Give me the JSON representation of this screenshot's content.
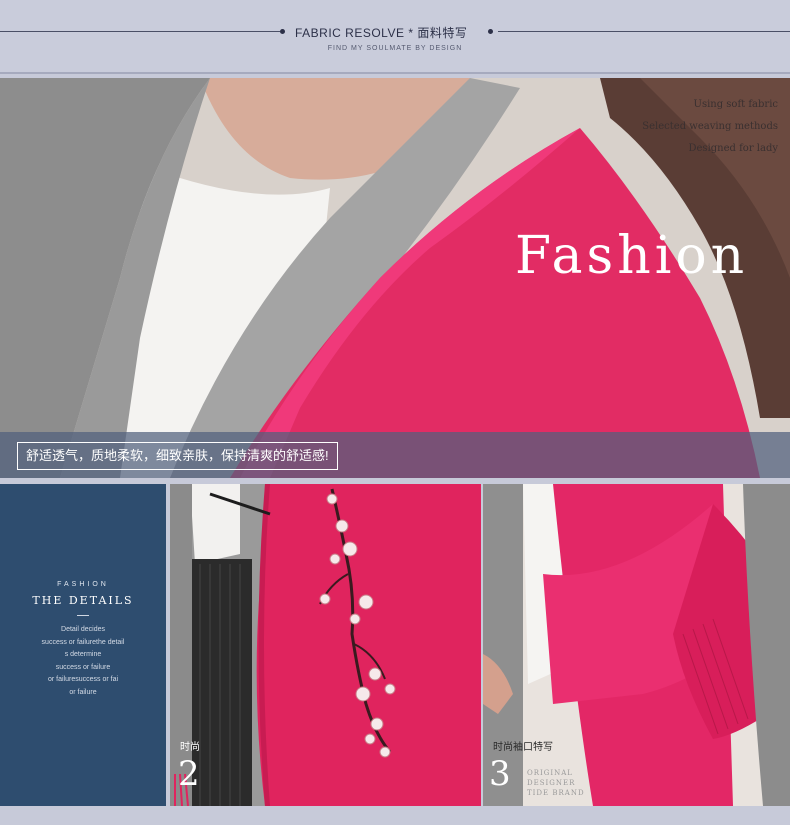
{
  "header": {
    "title": "FABRIC RESOLVE",
    "title_separator": "*",
    "title_cn": "面料特写",
    "subtitle": "FIND MY SOULMATE BY DESIGN"
  },
  "hero": {
    "side_lines": [
      "Using soft fabric",
      "Selected weaving methods",
      "Designed for lady"
    ],
    "headline": "Fashion",
    "caption": "舒适透气，质地柔软，细致亲肤，保持清爽的舒适感!"
  },
  "details_panel": {
    "kicker": "FASHION",
    "title": "THE DETAILS",
    "lines": [
      "Detail decides",
      "success or failurethe detail",
      "s determine",
      "success or failure",
      "or failuresuccess or fai",
      "or failure"
    ]
  },
  "photo_2": {
    "label": "时尚",
    "number": "2"
  },
  "photo_3": {
    "label": "时尚袖口特写",
    "number": "3",
    "sub_lines": [
      "ORIGINAL",
      "DESIGNER",
      "TIDE BRAND"
    ]
  },
  "colors": {
    "brand_navy": "#2e4d6f",
    "accent_pink": "#e0245e",
    "coat_gray": "#8e8e8e",
    "header_bg": "#c9ccdb"
  }
}
